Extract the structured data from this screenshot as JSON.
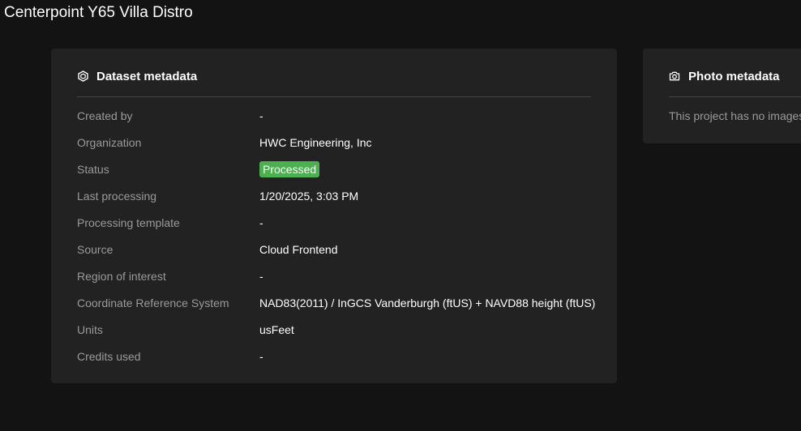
{
  "page": {
    "title": "Centerpoint Y65 Villa Distro"
  },
  "dataset_card": {
    "icon": "cube-outline-icon",
    "title": "Dataset metadata",
    "rows": [
      {
        "label": "Created by",
        "value": "-"
      },
      {
        "label": "Organization",
        "value": "HWC Engineering, Inc"
      },
      {
        "label": "Status",
        "value": "Processed"
      },
      {
        "label": "Last processing",
        "value": "1/20/2025, 3:03 PM"
      },
      {
        "label": "Processing template",
        "value": "-"
      },
      {
        "label": "Source",
        "value": "Cloud Frontend"
      },
      {
        "label": "Region of interest",
        "value": "-"
      },
      {
        "label": "Coordinate Reference System",
        "value": "NAD83(2011) / InGCS Vanderburgh (ftUS) + NAVD88 height (ftUS)"
      },
      {
        "label": "Units",
        "value": "usFeet"
      },
      {
        "label": "Credits used",
        "value": "-"
      }
    ]
  },
  "photo_card": {
    "icon": "camera-icon",
    "title": "Photo metadata",
    "empty_text": "This project has no images"
  },
  "colors": {
    "background": "#131313",
    "card": "#222222",
    "status_processed": "#4caf50",
    "label_text": "#9a9a9a"
  }
}
